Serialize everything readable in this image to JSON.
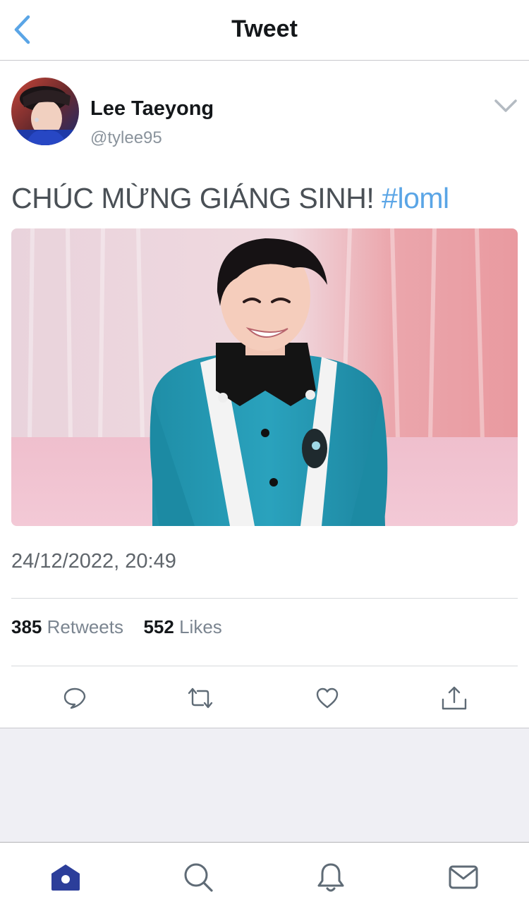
{
  "header": {
    "title": "Tweet",
    "back_icon": "chevron-left-icon"
  },
  "tweet": {
    "author": {
      "name": "Lee Taeyong",
      "handle": "@tylee95"
    },
    "text_main": "CHÚC MỪNG GIÁNG SINH! ",
    "hashtag": "#loml",
    "timestamp": "24/12/2022, 20:49",
    "stats": {
      "retweets_count": "385",
      "retweets_label": " Retweets",
      "likes_count": "552",
      "likes_label": " Likes"
    },
    "actions": [
      "reply-icon",
      "retweet-icon",
      "like-icon",
      "share-icon"
    ]
  },
  "tabbar": {
    "items": [
      "home-icon",
      "search-icon",
      "notifications-icon",
      "messages-icon"
    ],
    "active": "home-icon"
  },
  "colors": {
    "accent": "#5aa5e6",
    "tab_active": "#2c3e9a",
    "icon_gray": "#8a939c"
  }
}
